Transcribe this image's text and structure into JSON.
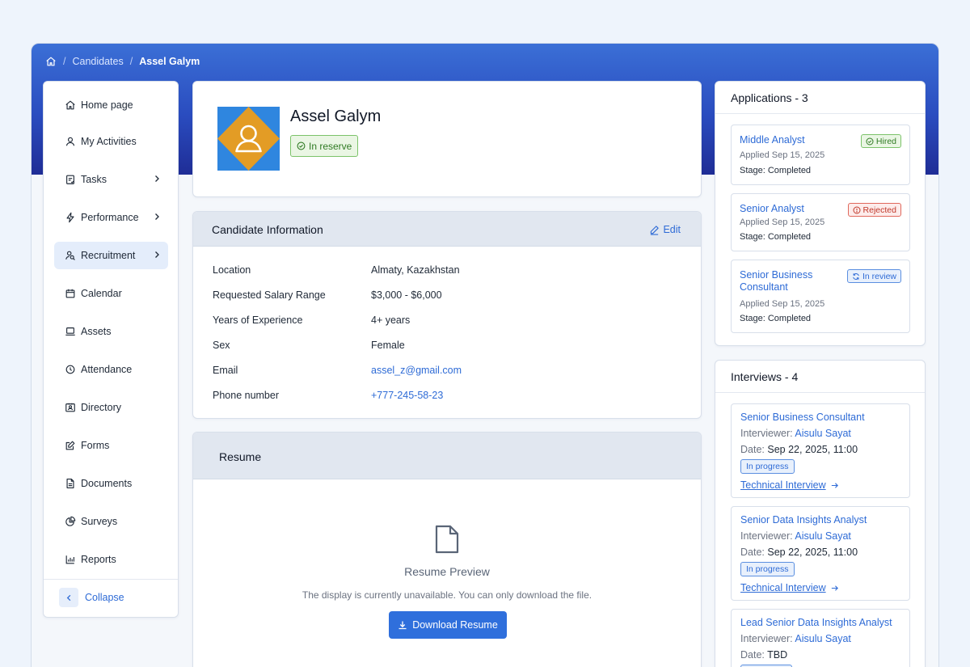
{
  "breadcrumb": {
    "home_icon": "home-icon",
    "items": [
      "Candidates",
      "Assel Galym"
    ]
  },
  "sidebar": {
    "items": [
      {
        "label": "Home page",
        "icon": "home-icon",
        "chevron": false,
        "active": false
      },
      {
        "label": "My Activities",
        "icon": "user-icon",
        "chevron": false,
        "active": false
      },
      {
        "label": "Tasks",
        "icon": "clipboard-icon",
        "chevron": true,
        "active": false
      },
      {
        "label": "Performance",
        "icon": "lightning-icon",
        "chevron": true,
        "active": false
      },
      {
        "label": "Recruitment",
        "icon": "people-search-icon",
        "chevron": true,
        "active": true
      },
      {
        "label": "Calendar",
        "icon": "calendar-icon",
        "chevron": false,
        "active": false
      },
      {
        "label": "Assets",
        "icon": "laptop-icon",
        "chevron": false,
        "active": false
      },
      {
        "label": "Attendance",
        "icon": "clock-icon",
        "chevron": false,
        "active": false
      },
      {
        "label": "Directory",
        "icon": "contact-card-icon",
        "chevron": false,
        "active": false
      },
      {
        "label": "Forms",
        "icon": "edit-form-icon",
        "chevron": false,
        "active": false
      },
      {
        "label": "Documents",
        "icon": "document-icon",
        "chevron": false,
        "active": false
      },
      {
        "label": "Surveys",
        "icon": "pie-chart-icon",
        "chevron": false,
        "active": false
      },
      {
        "label": "Reports",
        "icon": "bar-chart-icon",
        "chevron": false,
        "active": false
      }
    ],
    "collapse_label": "Collapse"
  },
  "profile": {
    "name": "Assel Galym",
    "status": "In reserve",
    "avatar_icon": "user-avatar-icon"
  },
  "info": {
    "title": "Candidate Information",
    "edit_label": "Edit",
    "rows": [
      {
        "label": "Location",
        "value": "Almaty, Kazakhstan",
        "link": false
      },
      {
        "label": "Requested Salary Range",
        "value": "$3,000 - $6,000",
        "link": false
      },
      {
        "label": "Years of Experience",
        "value": "4+ years",
        "link": false
      },
      {
        "label": "Sex",
        "value": "Female",
        "link": false
      },
      {
        "label": "Email",
        "value": "assel_z@gmail.com",
        "link": true
      },
      {
        "label": "Phone number",
        "value": "+777-245-58-23",
        "link": true
      }
    ]
  },
  "resume": {
    "title": "Resume",
    "preview_title": "Resume Preview",
    "preview_sub": "The display is currently unavailable. You can only download the file.",
    "download_label": "Download Resume"
  },
  "applications": {
    "title": "Applications - 3",
    "items": [
      {
        "title": "Middle Analyst",
        "status": "Hired",
        "date": "Applied Sep 15, 2025",
        "stage": "Stage: Completed"
      },
      {
        "title": "Senior Analyst",
        "status": "Rejected",
        "date": "Applied Sep 15, 2025",
        "stage": "Stage: Completed"
      },
      {
        "title": "Senior Business Consultant",
        "status": "In review",
        "date": "Applied Sep 15, 2025",
        "stage": "Stage: Completed"
      }
    ]
  },
  "interviews": {
    "title": "Interviews - 4",
    "interviewer_label": "Interviewer:",
    "date_label": "Date:",
    "items": [
      {
        "title": "Senior Business Consultant",
        "interviewer": "Aisulu Sayat",
        "date": "Sep 22, 2025, 11:00",
        "status": "In progress",
        "link": "Technical Interview"
      },
      {
        "title": "Senior Data Insights Analyst",
        "interviewer": "Aisulu Sayat",
        "date": "Sep 22, 2025, 11:00",
        "status": "In progress",
        "link": "Technical Interview"
      },
      {
        "title": "Lead Senior Data Insights Analyst",
        "interviewer": "Aisulu Sayat",
        "date": "TBD",
        "status": "",
        "link": ""
      }
    ]
  }
}
